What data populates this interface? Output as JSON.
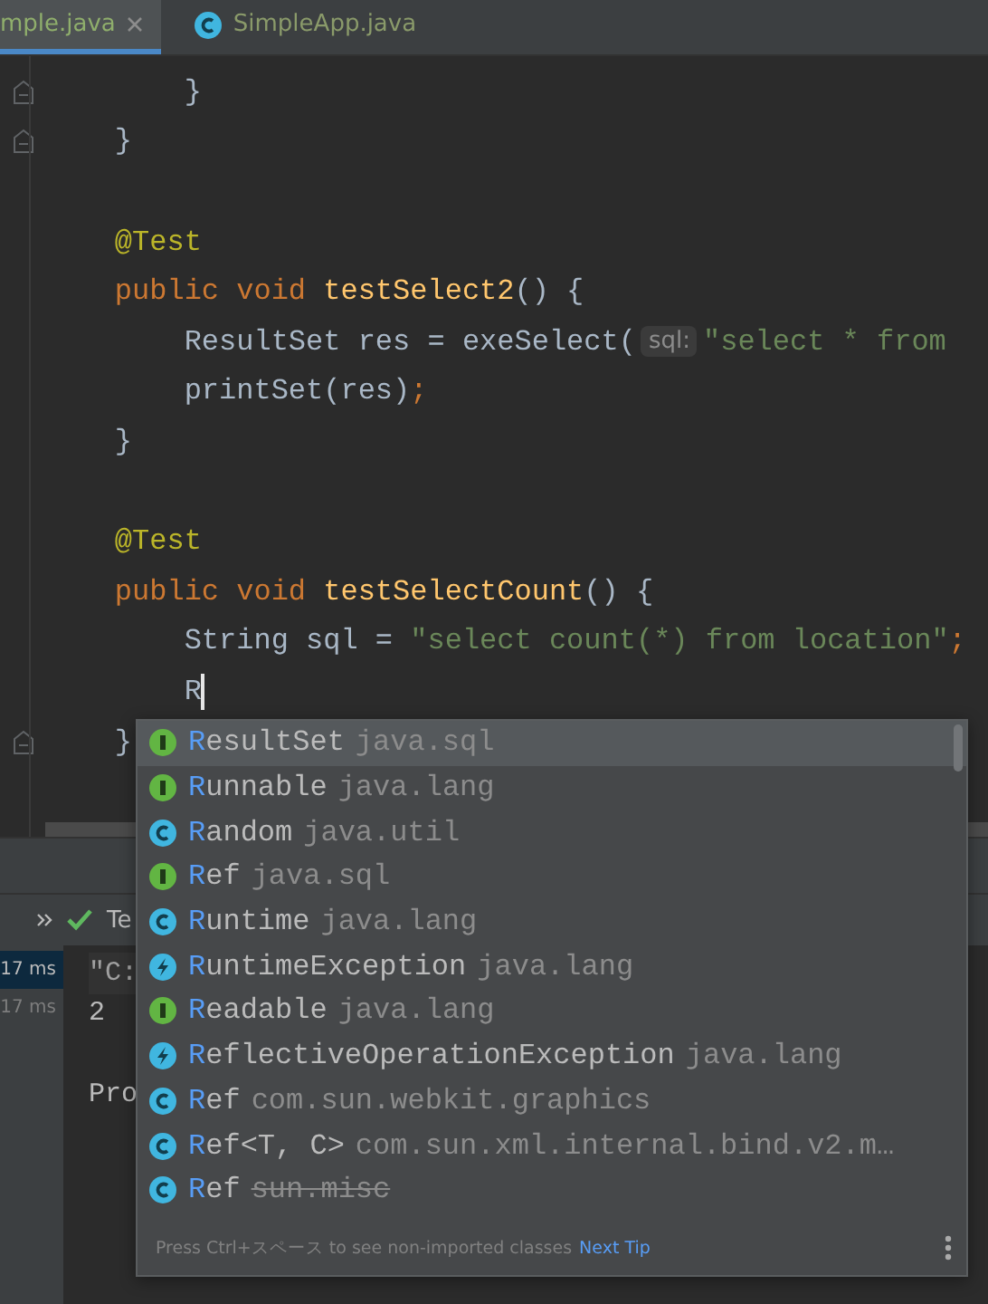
{
  "tabs": [
    {
      "label": "mple.java",
      "selected": true,
      "kind": "plain",
      "closable": true
    },
    {
      "label": "SimpleApp.java",
      "selected": false,
      "kind": "class",
      "closable": false
    }
  ],
  "editor": {
    "lines": [
      {
        "fold": true,
        "caret": false,
        "tokens": [
          {
            "kind": "plain",
            "text": "        }"
          }
        ]
      },
      {
        "fold": true,
        "caret": false,
        "tokens": [
          {
            "kind": "plain",
            "text": "    }"
          }
        ]
      },
      {
        "fold": false,
        "caret": false
      },
      {
        "fold": false,
        "caret": false,
        "tokens": [
          {
            "kind": "annotation",
            "text": "    @Test"
          }
        ]
      },
      {
        "fold": false,
        "caret": false,
        "tokens": [
          {
            "kind": "keyword",
            "text": "    public void "
          },
          {
            "kind": "method",
            "text": "testSelect2"
          },
          {
            "kind": "plain",
            "text": "() {"
          }
        ]
      },
      {
        "fold": false,
        "caret": false,
        "tokens": [
          {
            "kind": "plain",
            "text": "        ResultSet res = exeSelect("
          },
          {
            "kind": "hint",
            "text": "sql:"
          },
          {
            "kind": "string",
            "text": "\"select * from"
          }
        ]
      },
      {
        "fold": false,
        "caret": false,
        "tokens": [
          {
            "kind": "plain",
            "text": "        printSet(res)"
          },
          {
            "kind": "keyword",
            "text": ";"
          }
        ]
      },
      {
        "fold": false,
        "caret": false,
        "tokens": [
          {
            "kind": "plain",
            "text": "    }"
          }
        ]
      },
      {
        "fold": false,
        "caret": false
      },
      {
        "fold": false,
        "caret": false,
        "tokens": [
          {
            "kind": "annotation",
            "text": "    @Test"
          }
        ]
      },
      {
        "fold": false,
        "caret": false,
        "tokens": [
          {
            "kind": "keyword",
            "text": "    public void "
          },
          {
            "kind": "method",
            "text": "testSelectCount"
          },
          {
            "kind": "plain",
            "text": "() {"
          }
        ]
      },
      {
        "fold": false,
        "caret": false,
        "tokens": [
          {
            "kind": "plain",
            "text": "        String sql = "
          },
          {
            "kind": "string",
            "text": "\"select count(*) from location\""
          },
          {
            "kind": "keyword",
            "text": ";"
          }
        ]
      },
      {
        "fold": false,
        "caret": true,
        "tokens": [
          {
            "kind": "plain",
            "text": "        R"
          }
        ]
      },
      {
        "fold": true,
        "caret": false,
        "tokens": [
          {
            "kind": "plain",
            "text": "    }"
          }
        ]
      }
    ]
  },
  "run_panel": {
    "tab": "Te",
    "times": [
      {
        "text": "17 ms",
        "selected": true
      },
      {
        "text": "17 ms",
        "selected": false
      }
    ],
    "output": [
      "\"C:",
      "2",
      "Pro"
    ]
  },
  "completion": {
    "items": [
      {
        "kind": "interface",
        "match": "R",
        "rest": "esultSet",
        "package": "java.sql",
        "deprecated": false,
        "selected": true
      },
      {
        "kind": "interface",
        "match": "R",
        "rest": "unnable",
        "package": "java.lang",
        "deprecated": false,
        "selected": false
      },
      {
        "kind": "class",
        "match": "R",
        "rest": "andom",
        "package": "java.util",
        "deprecated": false,
        "selected": false
      },
      {
        "kind": "interface",
        "match": "R",
        "rest": "ef",
        "package": "java.sql",
        "deprecated": false,
        "selected": false
      },
      {
        "kind": "class",
        "match": "R",
        "rest": "untime",
        "package": "java.lang",
        "deprecated": false,
        "selected": false
      },
      {
        "kind": "exception",
        "match": "R",
        "rest": "untimeException",
        "package": "java.lang",
        "deprecated": false,
        "selected": false
      },
      {
        "kind": "interface",
        "match": "R",
        "rest": "eadable",
        "package": "java.lang",
        "deprecated": false,
        "selected": false
      },
      {
        "kind": "exception",
        "match": "R",
        "rest": "eflectiveOperationException",
        "package": "java.lang",
        "deprecated": false,
        "selected": false
      },
      {
        "kind": "class",
        "match": "R",
        "rest": "ef",
        "package": "com.sun.webkit.graphics",
        "deprecated": false,
        "selected": false
      },
      {
        "kind": "class",
        "match": "R",
        "rest": "ef<T, C>",
        "package": "com.sun.xml.internal.bind.v2.m…",
        "deprecated": false,
        "selected": false
      },
      {
        "kind": "class",
        "match": "R",
        "rest": "ef",
        "package": "sun.misc",
        "deprecated": true,
        "selected": false
      }
    ],
    "footer": "Press Ctrl+スペース to see non-imported classes",
    "footer_link": "Next Tip"
  }
}
